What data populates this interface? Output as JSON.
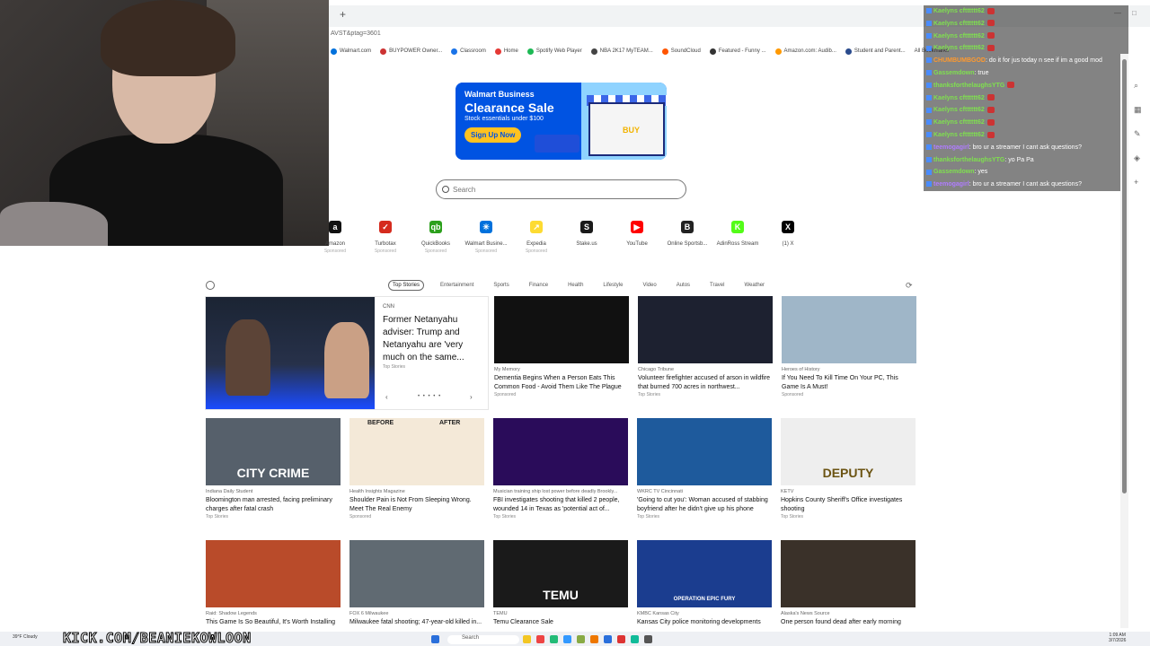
{
  "browser": {
    "url_fragment": "AVST&ptag=3601",
    "bookmarks": [
      "Walmart.com",
      "BUYPOWER Owner...",
      "Classroom",
      "Home",
      "Spotify Web Player",
      "NBA 2K17 MyTEAM...",
      "SoundCloud",
      "Featured - Funny ...",
      "Amazon.com: Audib...",
      "Student and Parent..."
    ],
    "all_bookmarks": "All Bookmarks"
  },
  "chat": [
    {
      "user": "Kaelyns cftttttt62",
      "msg": "",
      "color": "#7fe04f"
    },
    {
      "user": "Kaelyns cftttttt62",
      "msg": "",
      "color": "#7fe04f"
    },
    {
      "user": "Kaelyns cftttttt62",
      "msg": "",
      "color": "#7fe04f"
    },
    {
      "user": "Kaelyns cftttttt62",
      "msg": "",
      "color": "#7fe04f"
    },
    {
      "user": "CHUMBUMBGOD",
      "msg": ": do it for jus today n see if im a good mod",
      "color": "#ff9a2e"
    },
    {
      "user": "Gassemdown",
      "msg": ": true",
      "color": "#7fe04f"
    },
    {
      "user": "thanksforthelaughsYTG",
      "msg": "",
      "color": "#7fe04f"
    },
    {
      "user": "Kaelyns cftttttt62",
      "msg": "",
      "color": "#7fe04f"
    },
    {
      "user": "Kaelyns cftttttt62",
      "msg": "",
      "color": "#7fe04f"
    },
    {
      "user": "Kaelyns cftttttt62",
      "msg": "",
      "color": "#7fe04f"
    },
    {
      "user": "Kaelyns cftttttt62",
      "msg": "",
      "color": "#7fe04f"
    },
    {
      "user": "teemogagirl",
      "msg": ": bro ur a streamer I cant ask questions?",
      "color": "#b07cff"
    },
    {
      "user": "thanksforthelaughsYTG",
      "msg": ": yo Pa Pa",
      "color": "#7fe04f"
    },
    {
      "user": "Gassemdown",
      "msg": ": yes",
      "color": "#7fe04f"
    },
    {
      "user": "teemogagirl",
      "msg": ": bro ur a streamer I cant ask questions?",
      "color": "#b07cff"
    }
  ],
  "ad": {
    "brand": "Walmart Business",
    "title": "Clearance Sale",
    "subtitle": "Stock essentials under $100",
    "cta": "Sign Up Now",
    "buy": "BUY"
  },
  "search": {
    "placeholder": "Search"
  },
  "quicklinks": [
    {
      "label": "Amazon",
      "sponsored": "Sponsored",
      "color": "#111111",
      "glyph": "a"
    },
    {
      "label": "Turbotax",
      "sponsored": "Sponsored",
      "color": "#d52b1e",
      "glyph": "✓"
    },
    {
      "label": "QuickBooks",
      "sponsored": "Sponsored",
      "color": "#2ca01c",
      "glyph": "qb"
    },
    {
      "label": "Walmart Busine...",
      "sponsored": "Sponsored",
      "color": "#0071dc",
      "glyph": "✳"
    },
    {
      "label": "Expedia",
      "sponsored": "Sponsored",
      "color": "#fddb32",
      "glyph": "↗"
    },
    {
      "label": "Stake.us",
      "sponsored": "",
      "color": "#1a1a1a",
      "glyph": "S"
    },
    {
      "label": "YouTube",
      "sponsored": "",
      "color": "#ff0000",
      "glyph": "▶"
    },
    {
      "label": "Online Sportsb...",
      "sponsored": "",
      "color": "#222222",
      "glyph": "B"
    },
    {
      "label": "AdinRoss Stream",
      "sponsored": "",
      "color": "#53fc18",
      "glyph": "K"
    },
    {
      "label": "(1) X",
      "sponsored": "",
      "color": "#000000",
      "glyph": "X"
    }
  ],
  "news_tabs": [
    "Top Stories",
    "Entertainment",
    "Sports",
    "Finance",
    "Health",
    "Lifestyle",
    "Video",
    "Autos",
    "Travel",
    "Weather"
  ],
  "hero": {
    "source": "CNN",
    "title": "Former Netanyahu adviser: Trump and Netanyahu are 'very much on the same...",
    "tag": "Top Stories",
    "dots": "• • • • •"
  },
  "cards_row1": [
    {
      "source": "My Memory",
      "title": "Dementia Begins When a Person Eats This Common Food - Avoid Them Like The Plague",
      "tag": "Sponsored",
      "bg": "#111111"
    },
    {
      "source": "Chicago Tribune",
      "title": "Volunteer firefighter accused of arson in wildfire that burned 700 acres in northwest...",
      "tag": "Top Stories",
      "bg": "#1d2130"
    },
    {
      "source": "Heroes of History",
      "title": "If You Need To Kill Time On Your PC, This Game Is A Must!",
      "tag": "Sponsored",
      "bg": "#9fb6c8"
    }
  ],
  "cards_row2": [
    {
      "source": "Indiana Daily Student",
      "title": "Bloomington man arrested, facing preliminary charges after fatal crash",
      "tag": "Top Stories",
      "bg": "#56606b",
      "overlay": "CITY CRIME"
    },
    {
      "source": "Health Insights Magazine",
      "title": "Shoulder Pain is Not From Sleeping Wrong. Meet The Real Enemy",
      "tag": "Sponsored",
      "bg": "#f4e9d8",
      "overlay_before": "BEFORE",
      "overlay_after": "AFTER"
    },
    {
      "source": "Musician training ship lost power before deadly Brookly...",
      "title": "FBI investigates shooting that killed 2 people, wounded 14 in Texas as 'potential act of...",
      "tag": "Top Stories",
      "bg": "#2a0c5a"
    },
    {
      "source": "WKRC TV Cincinnati",
      "title": "'Going to cut you': Woman accused of stabbing boyfriend after he didn't give up his phone",
      "tag": "Top Stories",
      "bg": "#1e5a9c"
    },
    {
      "source": "KETV",
      "title": "Hopkins County Sheriff's Office investigates shooting",
      "tag": "Top Stories",
      "bg": "#eeeeee",
      "overlay": "DEPUTY"
    }
  ],
  "cards_row3": [
    {
      "source": "Raid: Shadow Legends",
      "title": "This Game Is So Beautiful, It's Worth Installing",
      "bg": "#b94b2a"
    },
    {
      "source": "FOX 6 Milwaukee",
      "title": "Milwaukee fatal shooting; 47-year-old killed in...",
      "bg": "#606a72"
    },
    {
      "source": "TEMU",
      "title": "Temu Clearance Sale",
      "bg": "#1a1a1a",
      "overlay": "TEMU"
    },
    {
      "source": "KMBC Kansas City",
      "title": "Kansas City police monitoring developments",
      "bg": "#1b3d8f",
      "overlay": "OPERATION EPIC FURY"
    },
    {
      "source": "Alaska's News Source",
      "title": "One person found dead after early morning",
      "bg": "#3a3129"
    }
  ],
  "taskbar": {
    "kick": "KICK.COM/BEANIEKOWLOON",
    "weather": "39°F Cloudy",
    "search": "Search",
    "time": "1:09 AM",
    "date": "3/7/2026"
  }
}
